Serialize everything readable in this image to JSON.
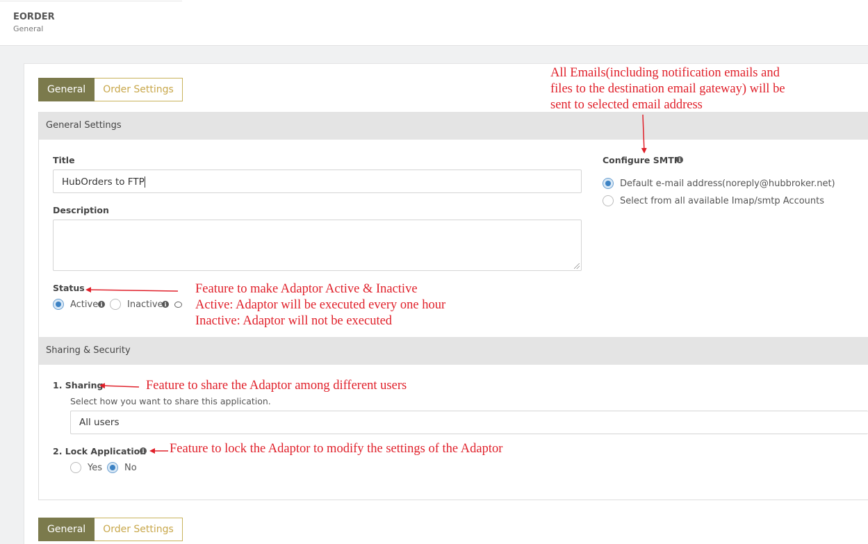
{
  "header": {
    "title": "EORDER",
    "subtitle": "General"
  },
  "tabs": [
    {
      "label": "General",
      "active": true
    },
    {
      "label": "Order Settings",
      "active": false
    }
  ],
  "general_settings": {
    "heading": "General Settings",
    "title_label": "Title",
    "title_value": "HubOrders to FTP",
    "description_label": "Description",
    "description_value": "",
    "status_label": "Status",
    "status_options": [
      {
        "label": "Active",
        "checked": true
      },
      {
        "label": "Inactive",
        "checked": false
      }
    ],
    "smtp_label": "Configure SMTP",
    "smtp_options": [
      {
        "label": "Default e-mail address",
        "detail": "(noreply@hubbroker.net)",
        "checked": true
      },
      {
        "label": "Select from all available Imap/smtp Accounts",
        "checked": false
      }
    ]
  },
  "sharing_security": {
    "heading": "Sharing & Security",
    "sharing_label": "1. Sharing",
    "sharing_help": "Select how you want to share this application.",
    "sharing_value": "All users",
    "lock_label": "2. Lock Application",
    "lock_options": [
      {
        "label": "Yes",
        "checked": false
      },
      {
        "label": "No",
        "checked": true
      }
    ]
  },
  "annotations": {
    "email_note": [
      "All Emails(including notification emails and",
      "files to the destination email gateway) will be",
      "sent to selected email address"
    ],
    "status_note": [
      "Feature to make Adaptor Active & Inactive",
      "Active: Adaptor will be executed every one hour",
      "Inactive: Adaptor will not be executed"
    ],
    "sharing_note": "Feature to share the Adaptor among different users",
    "lock_note": "Feature to lock the Adaptor to modify the settings of the Adaptor"
  },
  "colors": {
    "tab_active": "#7b7a4c",
    "tab_inactive_text": "#c8a74a",
    "annotation": "#e0202a",
    "radio_checked": "#3c82c4"
  }
}
